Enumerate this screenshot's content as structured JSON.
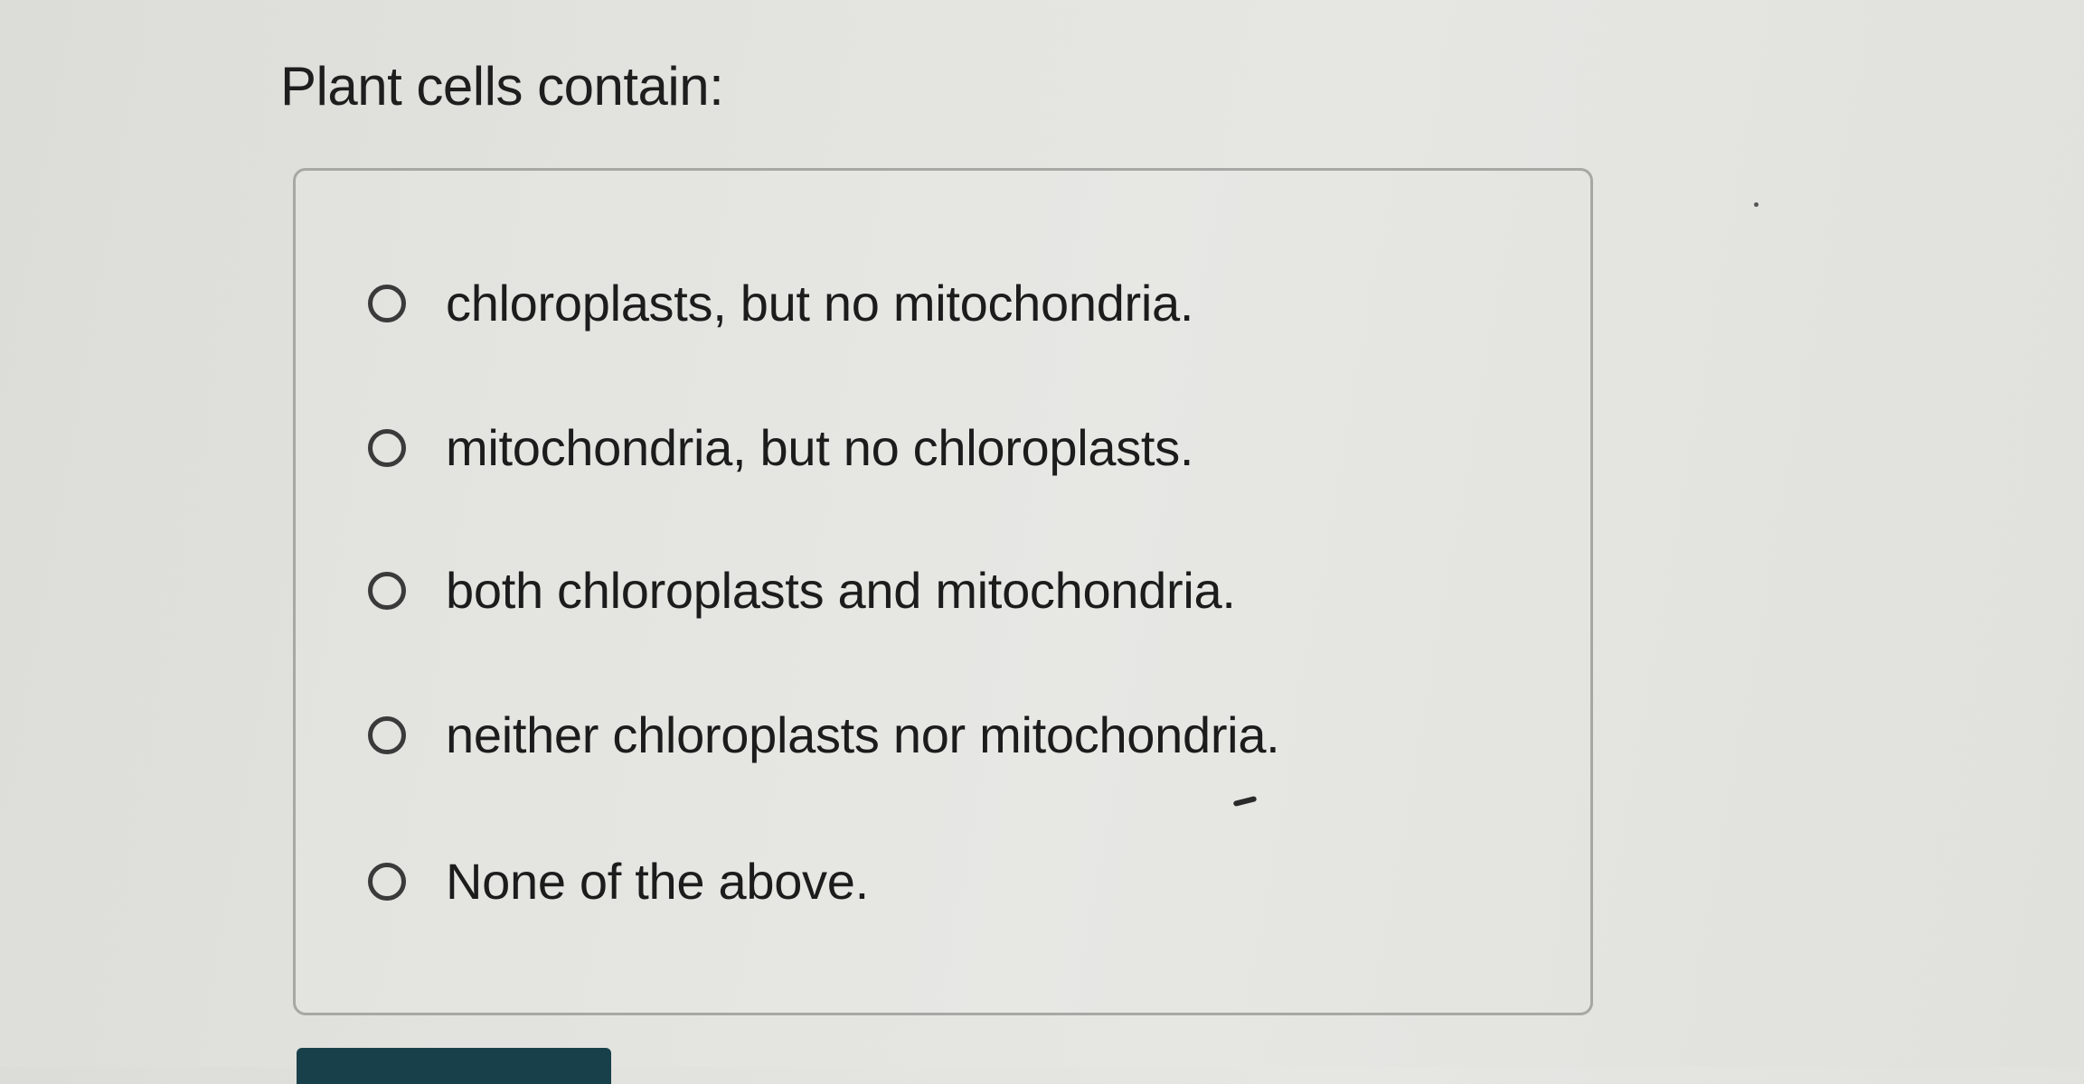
{
  "question": {
    "title": "Plant cells contain:"
  },
  "options": [
    {
      "label": "chloroplasts, but no mitochondria.",
      "selected": false
    },
    {
      "label": "mitochondria, but no chloroplasts.",
      "selected": false
    },
    {
      "label": "both chloroplasts and mitochondria.",
      "selected": false
    },
    {
      "label": "neither chloroplasts nor mitochondria.",
      "selected": false
    },
    {
      "label": "None of the above.",
      "selected": false
    }
  ],
  "colors": {
    "background": "#e2e2de",
    "text": "#1e1e1e",
    "radio_border": "#3a3a3a",
    "box_border": "#a7a7a4",
    "submit_button": "#18404b"
  },
  "icons": {
    "radio": "radio-unselected-icon"
  }
}
